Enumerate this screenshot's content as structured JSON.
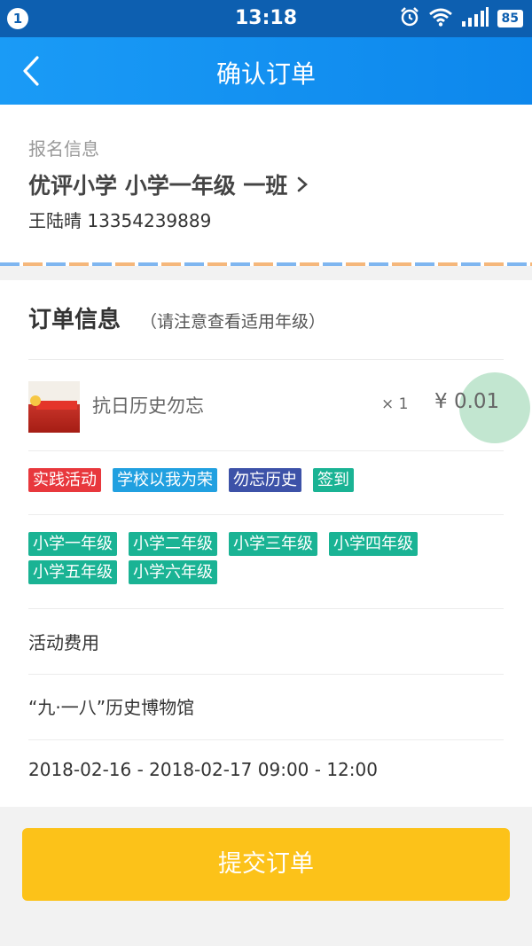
{
  "status_bar": {
    "notification_count": "1",
    "time": "13:18",
    "battery": "85"
  },
  "nav": {
    "title": "确认订单",
    "back_icon": "chevron-left-icon"
  },
  "registration": {
    "label": "报名信息",
    "school": "优评小学 小学一年级 一班",
    "contact": "王陆晴 13354239889"
  },
  "order": {
    "title": "订单信息",
    "hint": "（请注意查看适用年级）",
    "product": {
      "name": "抗日历史勿忘",
      "quantity": "× 1",
      "price": "¥ 0.01"
    },
    "tags": [
      {
        "label": "实践活动",
        "color": "#e8383d"
      },
      {
        "label": "学校以我为荣",
        "color": "#21a0e0"
      },
      {
        "label": "勿忘历史",
        "color": "#3d52a8"
      },
      {
        "label": "签到",
        "color": "#1ab394"
      }
    ],
    "grades": [
      "小学一年级",
      "小学二年级",
      "小学三年级",
      "小学四年级",
      "小学五年级",
      "小学六年级"
    ],
    "fee_label": "活动费用",
    "location": "“九·一八”历史博物馆",
    "datetime": "2018-02-16 - 2018-02-17 09:00 - 12:00"
  },
  "submit": {
    "label": "提交订单"
  }
}
